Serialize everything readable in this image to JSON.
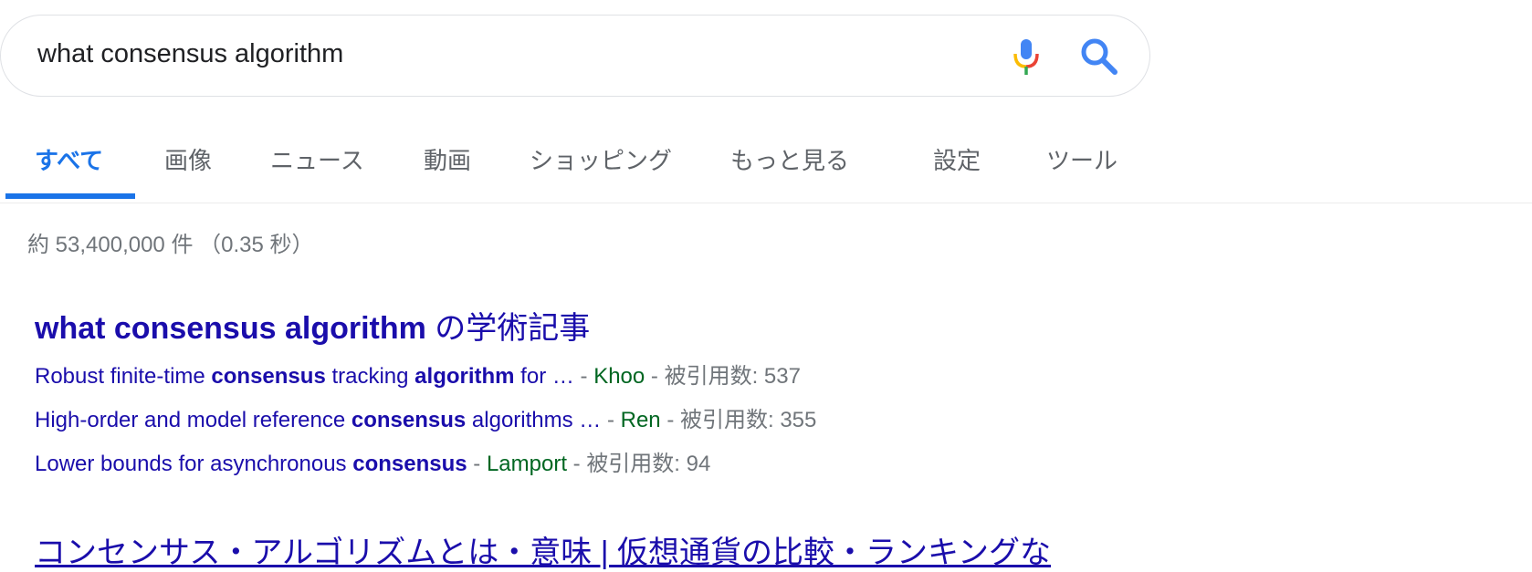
{
  "search": {
    "query": "what consensus algorithm"
  },
  "tabs": [
    {
      "label": "すべて",
      "active": true
    },
    {
      "label": "画像"
    },
    {
      "label": "ニュース"
    },
    {
      "label": "動画"
    },
    {
      "label": "ショッピング"
    },
    {
      "label": "もっと見る"
    },
    {
      "label": "設定"
    },
    {
      "label": "ツール"
    }
  ],
  "stats": "約 53,400,000 件 （0.35 秒）",
  "scholar": {
    "title_bold": "what consensus algorithm",
    "title_rest": " の学術記事",
    "items": [
      {
        "t1": "Robust finite-time ",
        "b1": "consensus",
        "t2": " tracking ",
        "b2": "algorithm",
        "t3": " for …",
        "sep": " - ",
        "author": "Khoo",
        "cites": " - 被引用数: 537"
      },
      {
        "t1": "High-order and model reference ",
        "b1": "consensus",
        "t2": " algorithms …",
        "b2": "",
        "t3": "",
        "sep": " - ",
        "author": "Ren",
        "cites": " - 被引用数: 355"
      },
      {
        "t1": "Lower bounds for asynchronous ",
        "b1": "consensus",
        "t2": "",
        "b2": "",
        "t3": "",
        "sep": " - ",
        "author": "Lamport",
        "cites": " - 被引用数: 94"
      }
    ]
  },
  "second_result": {
    "title": "コンセンサス・アルゴリズムとは・意味 | 仮想通貨の比較・ランキングな"
  },
  "colors": {
    "accent": "#1a73e8",
    "link": "#1a0dab",
    "author": "#006621",
    "muted": "#70757a"
  }
}
